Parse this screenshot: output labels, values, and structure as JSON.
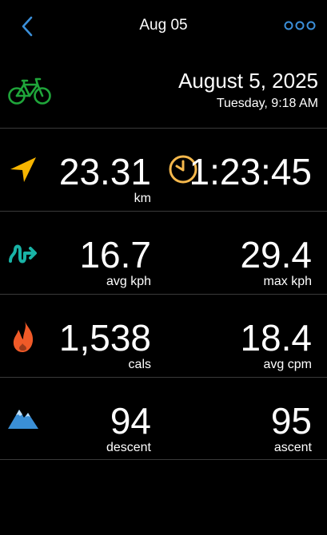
{
  "header": {
    "title": "Aug 05",
    "back_icon": "chevron-left-icon",
    "more_icon": "more-dots-icon",
    "accent_color": "#3b8fd9"
  },
  "activity": {
    "type_icon": "bike-icon",
    "icon_color": "#1fa53a",
    "date": "August 5, 2025",
    "day_time": "Tuesday, 9:18 AM"
  },
  "rows": [
    {
      "icon": "navigation-arrow-icon",
      "icon_color": "#f7b500",
      "left": {
        "value": "23.31",
        "unit": "km"
      },
      "right_icon": "clock-icon",
      "right_icon_color": "#f5b84c",
      "right": {
        "value": "1:23:45",
        "unit": ""
      }
    },
    {
      "icon": "speed-squiggle-icon",
      "icon_color": "#19b3a6",
      "left": {
        "value": "16.7",
        "unit": "avg kph"
      },
      "right": {
        "value": "29.4",
        "unit": "max kph"
      }
    },
    {
      "icon": "flame-icon",
      "icon_color": "#f05a28",
      "left": {
        "value": "1,538",
        "unit": "cals"
      },
      "right": {
        "value": "18.4",
        "unit": "avg cpm"
      }
    },
    {
      "icon": "mountain-icon",
      "icon_color": "#3a8fd6",
      "left": {
        "value": "94",
        "unit": "descent"
      },
      "right": {
        "value": "95",
        "unit": "ascent"
      }
    }
  ]
}
